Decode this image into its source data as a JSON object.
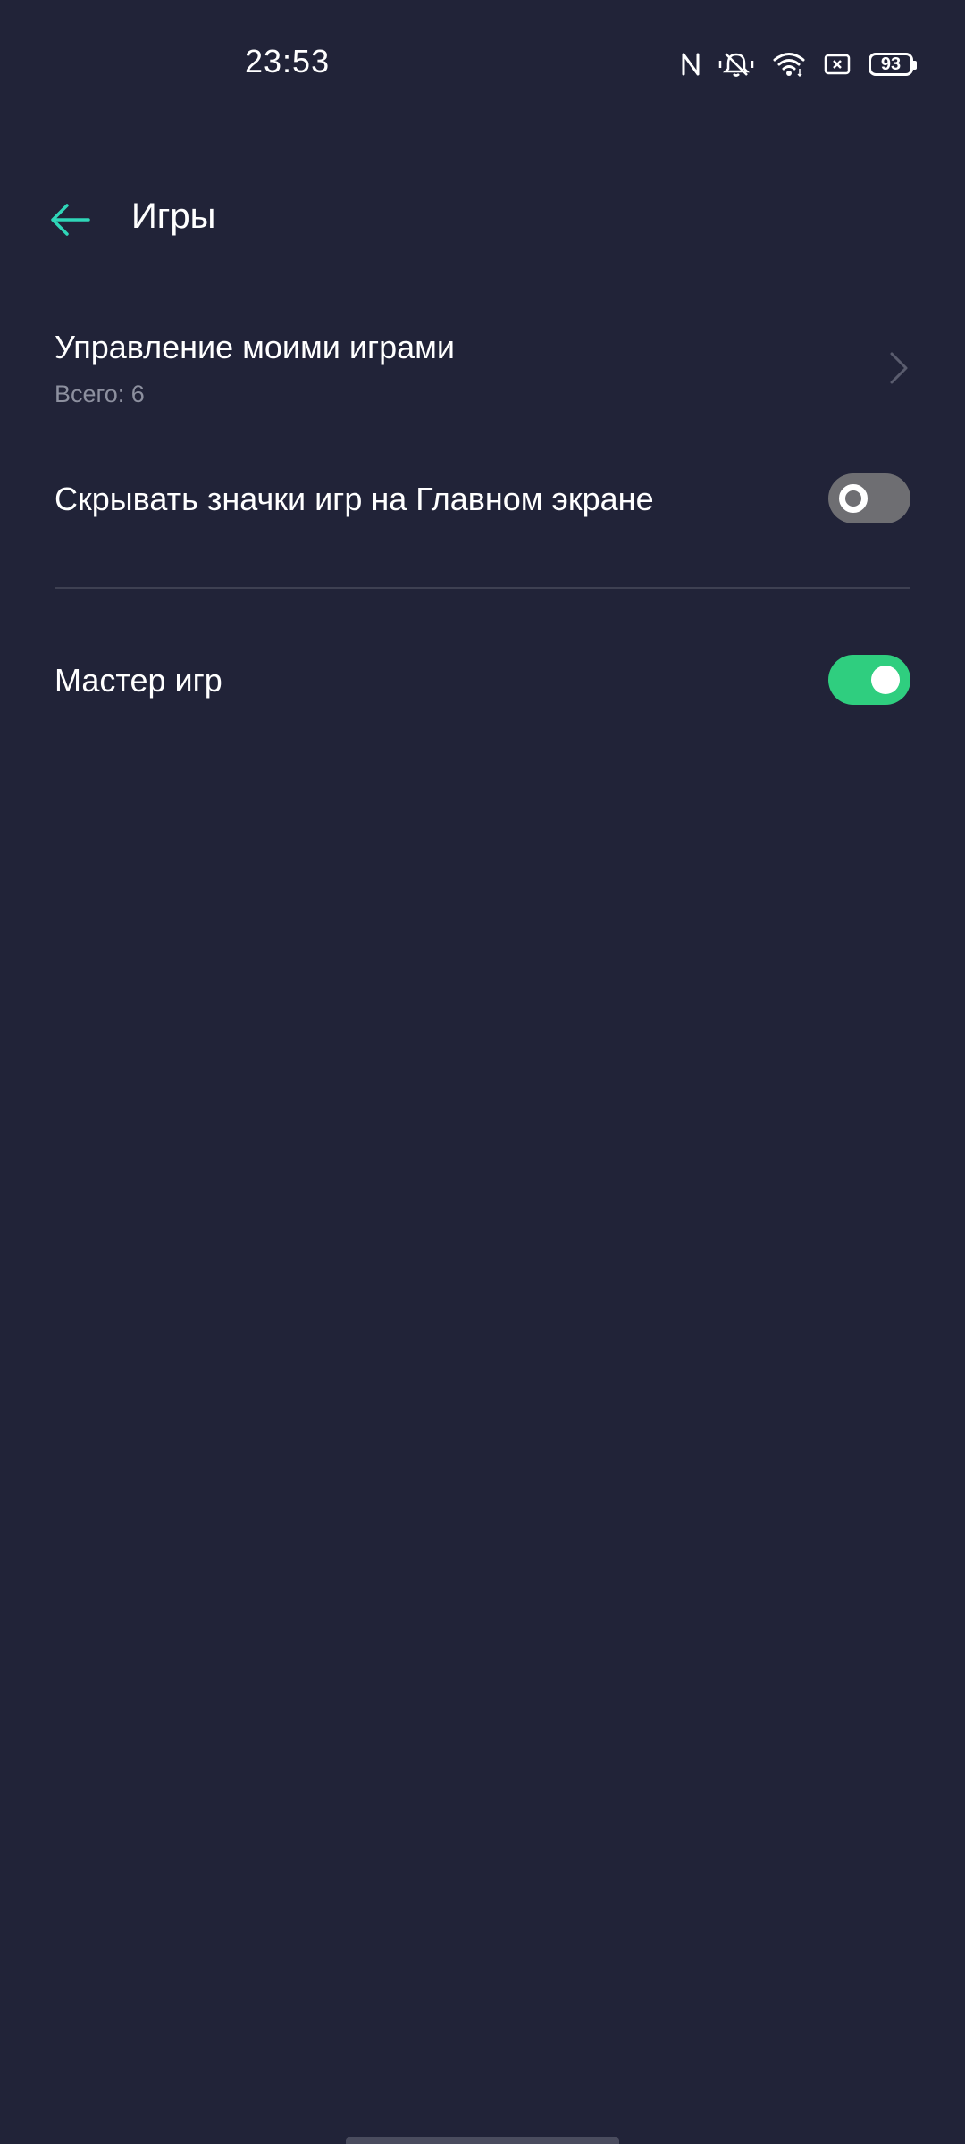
{
  "status_bar": {
    "time": "23:53",
    "battery_level": "93",
    "icons": [
      "nfc-icon",
      "muted-bell-icon",
      "wifi-icon",
      "sim-card-icon",
      "battery-icon"
    ]
  },
  "header": {
    "title": "Игры",
    "back_icon": "back-arrow-icon",
    "accent_color": "#2fd6b8"
  },
  "settings": {
    "manage_games": {
      "title": "Управление моими играми",
      "subtitle": "Всего: 6"
    },
    "hide_icons": {
      "title": "Скрывать значки игр на Главном экране",
      "enabled": false
    },
    "game_master": {
      "title": "Мастер игр",
      "enabled": true,
      "on_color": "#2fce7f"
    }
  }
}
